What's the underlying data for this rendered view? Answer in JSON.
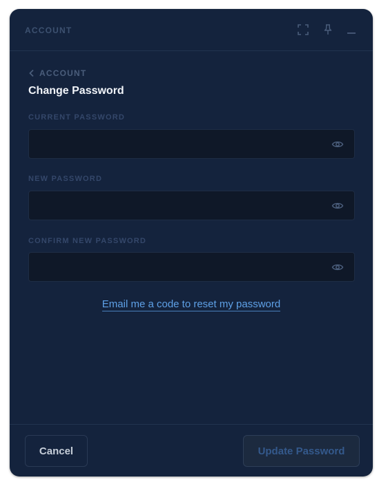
{
  "window": {
    "title": "ACCOUNT"
  },
  "titlebar_icons": [
    "expand-icon",
    "pin-icon",
    "minimize-icon"
  ],
  "breadcrumb": {
    "back_label": "ACCOUNT"
  },
  "page": {
    "title": "Change Password"
  },
  "fields": [
    {
      "label": "CURRENT PASSWORD",
      "value": "",
      "placeholder": ""
    },
    {
      "label": "NEW PASSWORD",
      "value": "",
      "placeholder": ""
    },
    {
      "label": "CONFIRM NEW PASSWORD",
      "value": "",
      "placeholder": ""
    }
  ],
  "reset_link": "Email me a code to reset my password",
  "footer": {
    "cancel_label": "Cancel",
    "submit_label": "Update Password"
  },
  "colors": {
    "panel_bg": "#14233d",
    "input_bg": "#0f1828",
    "link": "#5ea0e6",
    "title_text": "#f1f4f9"
  }
}
